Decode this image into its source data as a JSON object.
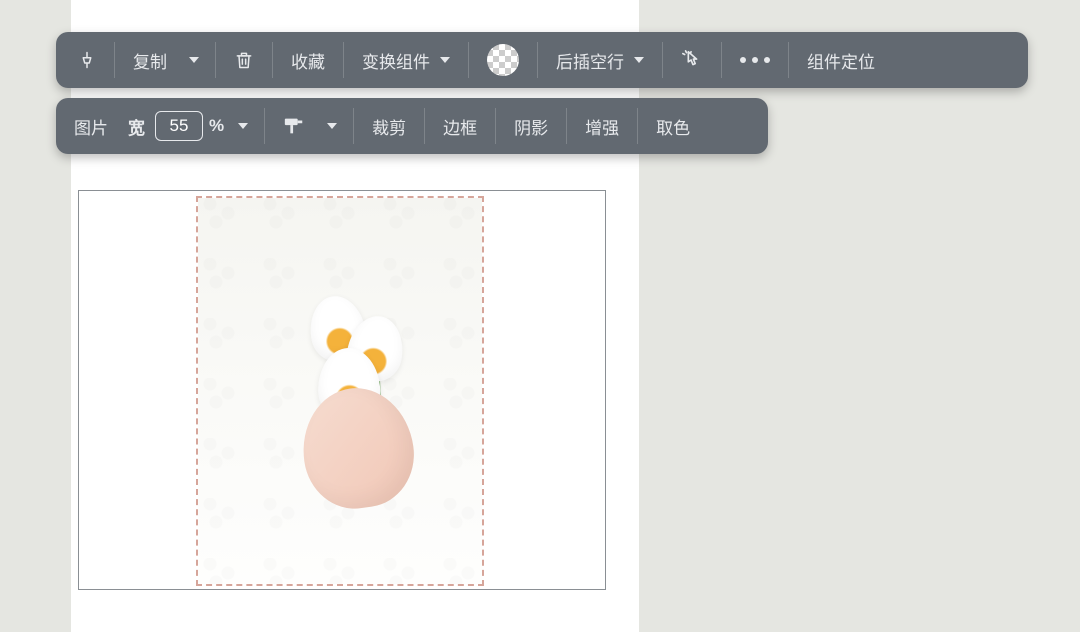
{
  "toolbar1": {
    "copy": "复制",
    "favorite": "收藏",
    "transform": "变换组件",
    "insertAfter": "后插空行",
    "locate": "组件定位"
  },
  "toolbar2": {
    "typeLabel": "图片",
    "widthLabel": "宽",
    "widthValue": "55",
    "percent": "%",
    "crop": "裁剪",
    "border": "边框",
    "shadow": "阴影",
    "enhance": "增强",
    "colorPick": "取色"
  }
}
